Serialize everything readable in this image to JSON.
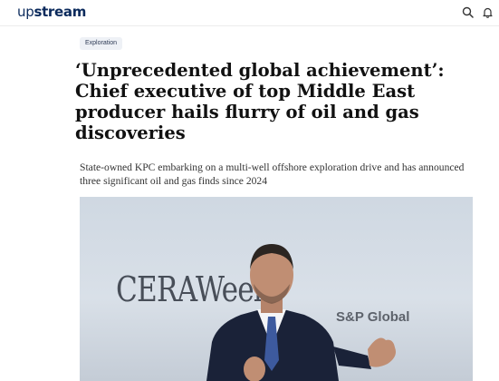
{
  "header": {
    "logo_lead": "up",
    "logo_rest": "stream",
    "icons": [
      "search-icon",
      "bell-icon"
    ]
  },
  "article": {
    "category": "Exploration",
    "headline": "‘Unprecedented global achievement’: Chief executive of top Middle East producer hails flurry of oil and gas discoveries",
    "standfirst": "State-owned KPC embarking on a multi-well offshore exploration drive and has announced three significant oil and gas finds since 2024",
    "hero_image": {
      "backdrop_text": "CERAWeek",
      "backdrop_logo": "S&P Global"
    }
  },
  "colors": {
    "brand": "#0b2a5c",
    "tag_bg": "#eef1f6"
  }
}
